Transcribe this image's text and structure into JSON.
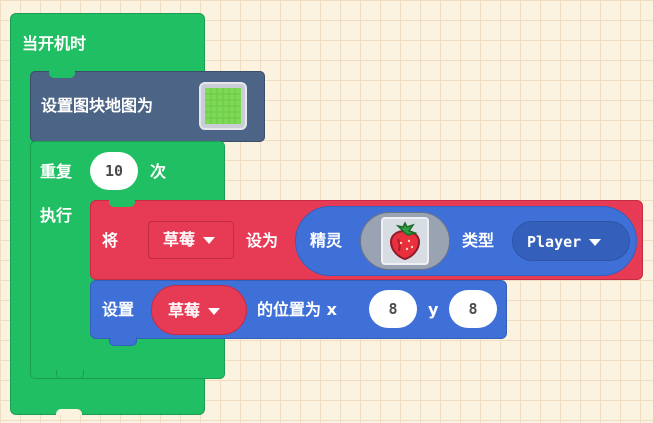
{
  "blocks": {
    "on_start": {
      "label": "当开机时"
    },
    "set_tilemap": {
      "label": "设置图块地图为"
    },
    "repeat": {
      "label_repeat": "重复",
      "count": "10",
      "label_times": "次",
      "label_do": "执行"
    },
    "set_sprite": {
      "label_set": "将",
      "variable": "草莓",
      "label_to": "设为",
      "label_sprite": "精灵",
      "label_kind": "类型",
      "kind_value": "Player"
    },
    "set_position": {
      "label_set": "设置",
      "variable": "草莓",
      "label_position": "的位置为 x",
      "x_value": "8",
      "label_y": "y",
      "y_value": "8"
    }
  },
  "colors": {
    "loops_green": "#21bf63",
    "tilemap_blue": "#4c6485",
    "sprites_red": "#e63a55",
    "sprites_blue": "#3f70d8"
  },
  "icons": [
    "tilemap-thumbnail-icon",
    "strawberry-sprite-icon",
    "dropdown-caret-icon"
  ]
}
